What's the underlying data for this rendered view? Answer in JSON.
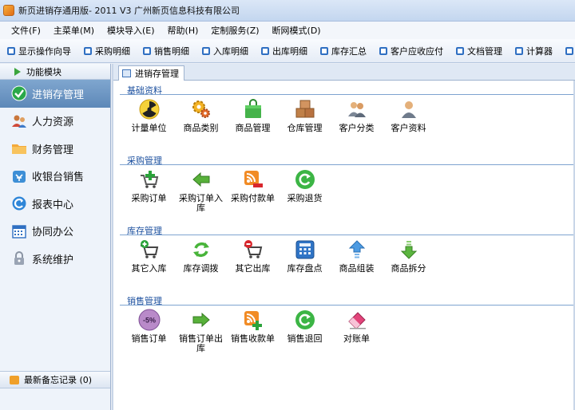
{
  "window": {
    "title": "新页进销存通用版- 2011 V3 广州新页信息科技有限公司"
  },
  "menubar": [
    "文件(F)",
    "主菜单(M)",
    "模块导入(E)",
    "帮助(H)",
    "定制服务(Z)",
    "断网模式(D)"
  ],
  "toolbar": [
    "显示操作向导",
    "采购明细",
    "销售明细",
    "入库明细",
    "出库明细",
    "库存汇总",
    "客户应收应付",
    "文档管理",
    "计算器",
    "快"
  ],
  "sidebar": {
    "header": "功能模块",
    "items": [
      {
        "label": "进销存管理",
        "icon": "check-circle-icon",
        "active": true
      },
      {
        "label": "人力资源",
        "icon": "people-icon",
        "active": false
      },
      {
        "label": "财务管理",
        "icon": "folder-icon",
        "active": false
      },
      {
        "label": "收银台销售",
        "icon": "cashier-icon",
        "active": false
      },
      {
        "label": "报表中心",
        "icon": "report-icon",
        "active": false
      },
      {
        "label": "协同办公",
        "icon": "calendar-icon",
        "active": false
      },
      {
        "label": "系统维护",
        "icon": "lock-icon",
        "active": false
      }
    ],
    "footer": "最新备忘记录 (0)"
  },
  "main": {
    "tab": "进销存管理",
    "sections": [
      {
        "title": "基础资料",
        "items": [
          {
            "label": "计量单位",
            "icon": "radiation-icon"
          },
          {
            "label": "商品类别",
            "icon": "gears-icon"
          },
          {
            "label": "商品管理",
            "icon": "shopping-bag-icon"
          },
          {
            "label": "仓库管理",
            "icon": "boxes-icon"
          },
          {
            "label": "客户分类",
            "icon": "users-group-icon"
          },
          {
            "label": "客户资料",
            "icon": "user-icon"
          }
        ]
      },
      {
        "title": "采购管理",
        "items": [
          {
            "label": "采购订单",
            "icon": "cart-add-icon"
          },
          {
            "label": "采购订单入库",
            "icon": "arrow-left-icon"
          },
          {
            "label": "采购付款单",
            "icon": "rss-minus-icon"
          },
          {
            "label": "采购退货",
            "icon": "refresh-green-icon"
          }
        ]
      },
      {
        "title": "库存管理",
        "items": [
          {
            "label": "其它入库",
            "icon": "cart-plus-icon"
          },
          {
            "label": "库存调拨",
            "icon": "recycle-icon"
          },
          {
            "label": "其它出库",
            "icon": "cart-minus-icon"
          },
          {
            "label": "库存盘点",
            "icon": "calculator-icon"
          },
          {
            "label": "商品组装",
            "icon": "arrow-up-icon"
          },
          {
            "label": "商品拆分",
            "icon": "arrow-down-icon"
          }
        ]
      },
      {
        "title": "销售管理",
        "items": [
          {
            "label": "销售订单",
            "icon": "discount-badge-icon",
            "badge": "-5%"
          },
          {
            "label": "销售订单出库",
            "icon": "arrow-right-icon"
          },
          {
            "label": "销售收款单",
            "icon": "rss-plus-icon"
          },
          {
            "label": "销售退回",
            "icon": "refresh-green-icon"
          },
          {
            "label": "对账单",
            "icon": "eraser-icon"
          }
        ]
      }
    ]
  }
}
